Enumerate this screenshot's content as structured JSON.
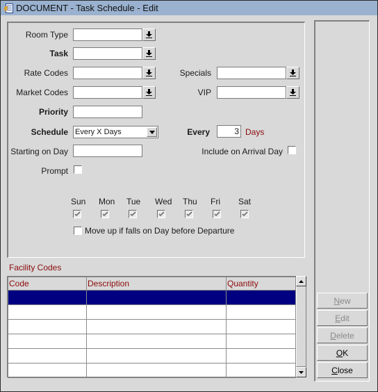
{
  "window": {
    "title": "DOCUMENT - Task Schedule - Edit",
    "icon": "document-app-icon"
  },
  "form": {
    "room_type": {
      "label": "Room Type",
      "value": ""
    },
    "task": {
      "label": "Task",
      "value": ""
    },
    "rate_codes": {
      "label": "Rate Codes",
      "value": ""
    },
    "market_codes": {
      "label": "Market Codes",
      "value": ""
    },
    "priority": {
      "label": "Priority",
      "value": ""
    },
    "specials": {
      "label": "Specials",
      "value": ""
    },
    "vip": {
      "label": "VIP",
      "value": ""
    },
    "schedule": {
      "label": "Schedule",
      "value": "Every X Days"
    },
    "every": {
      "label": "Every",
      "value": "3",
      "unit": "Days"
    },
    "starting_on_day": {
      "label": "Starting on Day",
      "value": ""
    },
    "include_on_arrival_day": {
      "label": "Include on Arrival Day",
      "checked": false
    },
    "prompt": {
      "label": "Prompt",
      "checked": false
    },
    "days": [
      {
        "label": "Sun",
        "checked": true
      },
      {
        "label": "Mon",
        "checked": true
      },
      {
        "label": "Tue",
        "checked": true
      },
      {
        "label": "Wed",
        "checked": true
      },
      {
        "label": "Thu",
        "checked": true
      },
      {
        "label": "Fri",
        "checked": true
      },
      {
        "label": "Sat",
        "checked": true
      }
    ],
    "move_up": {
      "label": "Move up if falls on Day before Departure",
      "checked": false
    }
  },
  "facility_codes": {
    "title": "Facility Codes",
    "columns": [
      "Code",
      "Description",
      "Quantity"
    ],
    "rows": [
      [
        "",
        "",
        ""
      ],
      [
        "",
        "",
        ""
      ],
      [
        "",
        "",
        ""
      ],
      [
        "",
        "",
        ""
      ],
      [
        "",
        "",
        ""
      ],
      [
        "",
        "",
        ""
      ]
    ],
    "selected_row": 0
  },
  "buttons": {
    "new": {
      "label": "New",
      "mnemonic": "N",
      "rest": "ew",
      "enabled": false
    },
    "edit": {
      "label": "Edit",
      "mnemonic": "E",
      "rest": "dit",
      "enabled": false
    },
    "delete": {
      "label": "Delete",
      "mnemonic": "D",
      "rest": "elete",
      "enabled": false
    },
    "ok": {
      "label": "OK",
      "mnemonic": "O",
      "rest": "K",
      "enabled": true
    },
    "close": {
      "label": "Close",
      "mnemonic": "C",
      "rest": "lose",
      "enabled": true
    }
  },
  "colors": {
    "titlebar": "#9ab2d0",
    "accent_red": "#8b0a0a",
    "selected_row": "#000080",
    "background": "#d9d9d9"
  }
}
